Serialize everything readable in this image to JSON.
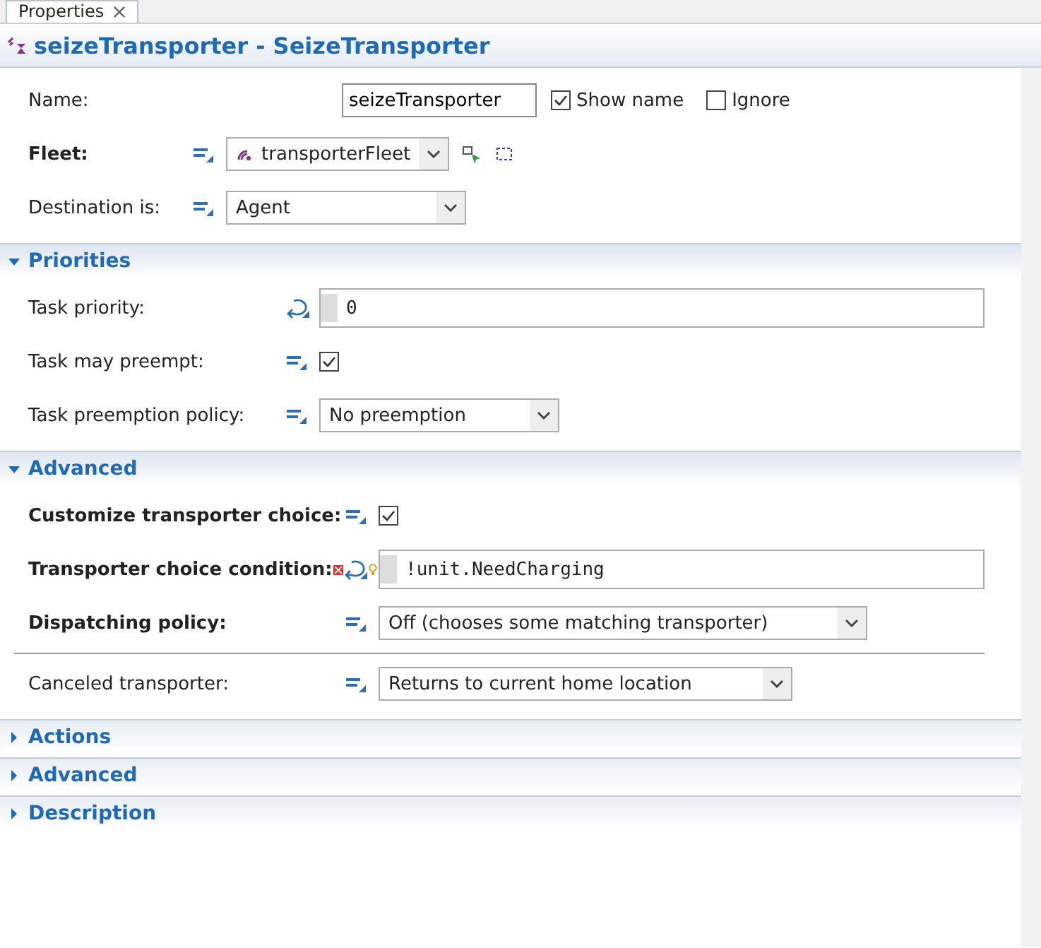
{
  "tab": {
    "label": "Properties"
  },
  "title": "seizeTransporter - SeizeTransporter",
  "general": [
    {
      "kind": "name",
      "label": "Name:",
      "emphasized": false,
      "value": "seizeTransporter",
      "checks": [
        {
          "label": "Show name",
          "checked": true
        },
        {
          "label": "Ignore",
          "checked": false
        }
      ]
    },
    {
      "kind": "fleet",
      "label": "Fleet:",
      "emphasized": true,
      "value": "transporterFleet"
    },
    {
      "kind": "dropdown",
      "label": "Destination is:",
      "emphasized": false,
      "value": "Agent"
    }
  ],
  "sections": [
    {
      "title": "Priorities",
      "expanded": true,
      "rows": [
        {
          "kind": "code",
          "label": "Task priority:",
          "emphasized": false,
          "value": "0"
        },
        {
          "kind": "checkbox",
          "label": "Task may preempt:",
          "emphasized": false,
          "checked": true
        },
        {
          "kind": "dropdown",
          "label": "Task preemption policy:",
          "emphasized": false,
          "value": "No preemption"
        }
      ]
    },
    {
      "title": "Advanced",
      "expanded": true,
      "rows": [
        {
          "kind": "checkbox",
          "label": "Customize transporter choice:",
          "emphasized": true,
          "checked": true
        },
        {
          "kind": "code",
          "label": "Transporter choice condition:",
          "emphasized": true,
          "error": true,
          "value": "!unit.NeedCharging"
        },
        {
          "kind": "dropdown",
          "label": "Dispatching policy:",
          "emphasized": true,
          "value": "Off (chooses some matching transporter)"
        },
        {
          "kind": "separator"
        },
        {
          "kind": "dropdown",
          "label": "Canceled transporter:",
          "emphasized": false,
          "value": "Returns to current home location"
        }
      ]
    },
    {
      "title": "Actions",
      "expanded": false
    },
    {
      "title": "Advanced",
      "expanded": false
    },
    {
      "title": "Description",
      "expanded": false
    }
  ]
}
